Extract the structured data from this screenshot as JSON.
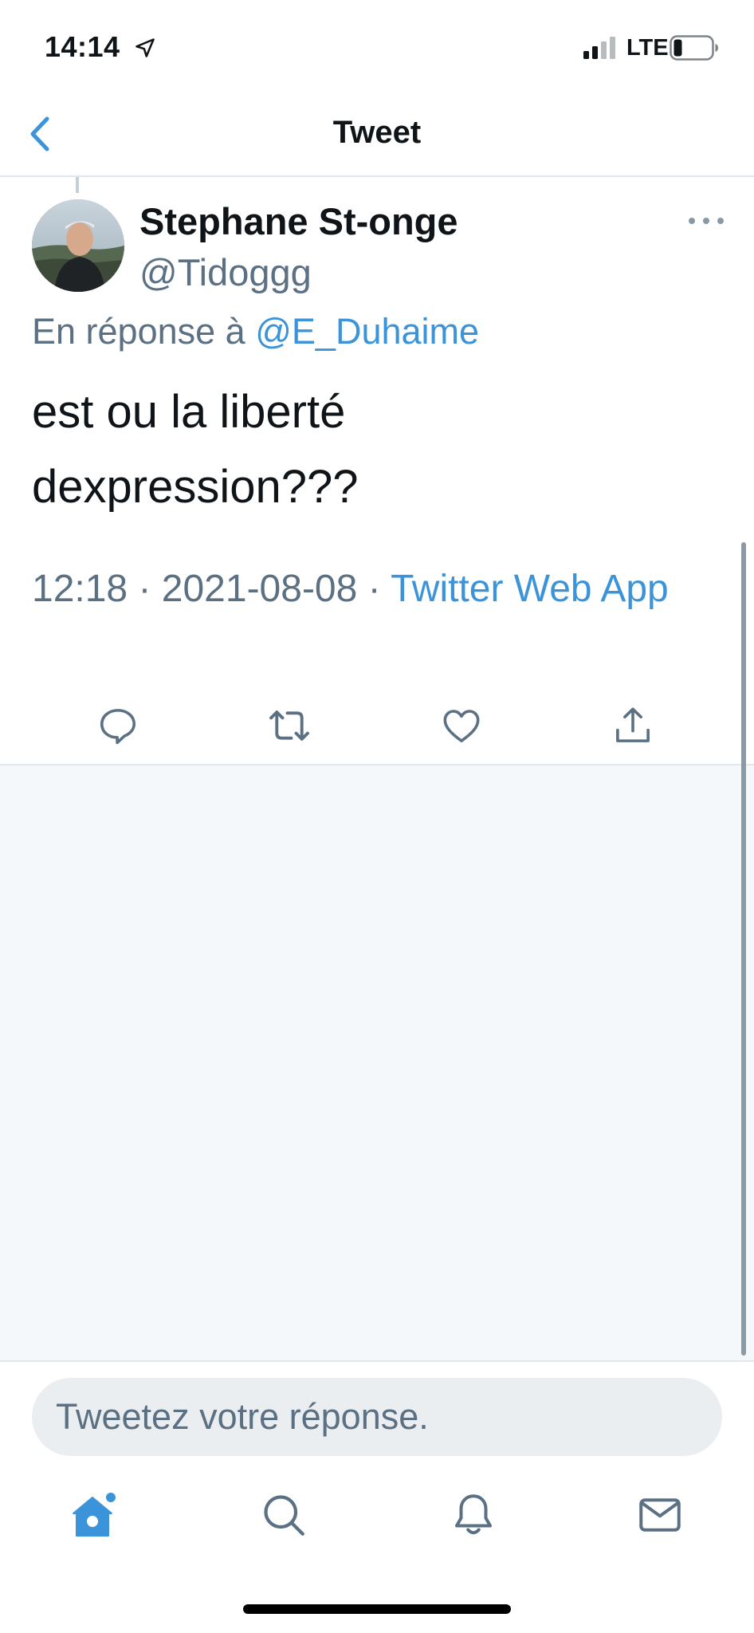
{
  "status_bar": {
    "time": "14:14",
    "network": "LTE",
    "location_icon": "location-arrow-icon",
    "signal_icon": "cellular-signal-icon",
    "battery_icon": "battery-icon",
    "battery_level": 0.2
  },
  "header": {
    "title": "Tweet",
    "back_icon": "chevron-left-icon"
  },
  "tweet": {
    "author_name": "Stephane St-onge",
    "author_handle": "@Tidoggg",
    "reply_prefix": "En réponse à",
    "reply_mention": "@E_Duhaime",
    "text_line1": "est ou la liberté",
    "text_line2": "dexpression???",
    "time": "12:18",
    "separator": " · ",
    "date": "2021-08-08",
    "source": "Twitter Web App",
    "more_icon": "more-horizontal-icon"
  },
  "actions": [
    {
      "name": "reply",
      "icon": "reply-icon"
    },
    {
      "name": "retweet",
      "icon": "retweet-icon"
    },
    {
      "name": "like",
      "icon": "heart-icon"
    },
    {
      "name": "share",
      "icon": "share-icon"
    }
  ],
  "compose": {
    "placeholder": "Tweetez votre réponse."
  },
  "tab_bar": [
    {
      "name": "home",
      "icon": "home-icon",
      "active": true
    },
    {
      "name": "search",
      "icon": "search-icon",
      "active": false
    },
    {
      "name": "notifications",
      "icon": "bell-icon",
      "active": false
    },
    {
      "name": "messages",
      "icon": "mail-icon",
      "active": false
    }
  ],
  "colors": {
    "accent": "#3b94d9",
    "text_primary": "#0f1419",
    "text_secondary": "#5b7083",
    "icon_gray": "#5b7083",
    "background_gray": "#f5f8fa"
  }
}
